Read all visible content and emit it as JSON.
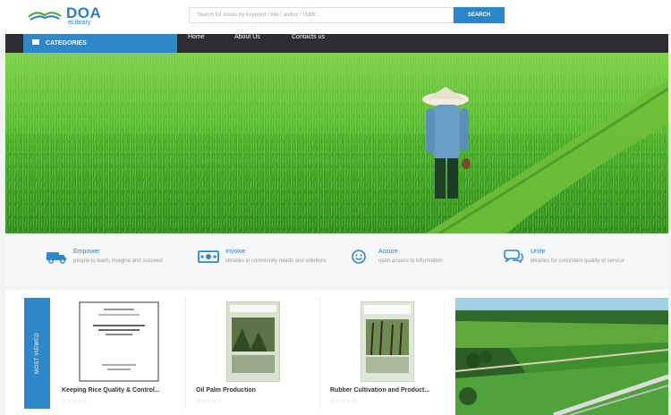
{
  "header": {
    "logo_title": "DOA",
    "logo_subtitle": "eLibrary",
    "search_placeholder": "Search for books by keyword / title / author / ISBN ...",
    "search_label": "SEARCH"
  },
  "nav": {
    "categories_label": "CATEGORIES",
    "links": [
      "Home",
      "About Us",
      "Contacts us"
    ]
  },
  "features": [
    {
      "title": "Empower",
      "desc": "people to learn, imagine and succeed",
      "icon": "truck-icon"
    },
    {
      "title": "Involve",
      "desc": "libraries in community needs and solutions",
      "icon": "money-icon"
    },
    {
      "title": "Assure",
      "desc": "open access to information",
      "icon": "smiley-icon"
    },
    {
      "title": "Unite",
      "desc": "libraries for consistent quality of service",
      "icon": "chat-icon"
    }
  ],
  "books_section": {
    "heading": "MOST VIEWED",
    "books": [
      {
        "title": "Keeping Rice Quality & Control...",
        "stars": "☆☆☆☆☆"
      },
      {
        "title": "Oil Palm Production",
        "stars": "☆☆☆☆☆"
      },
      {
        "title": "Rubber Cultivation and Product...",
        "stars": "☆☆☆☆☆"
      }
    ]
  },
  "colors": {
    "brand_blue": "#2d87c8",
    "nav_dark": "#2b2d30",
    "field_green": "#3fae2a"
  }
}
